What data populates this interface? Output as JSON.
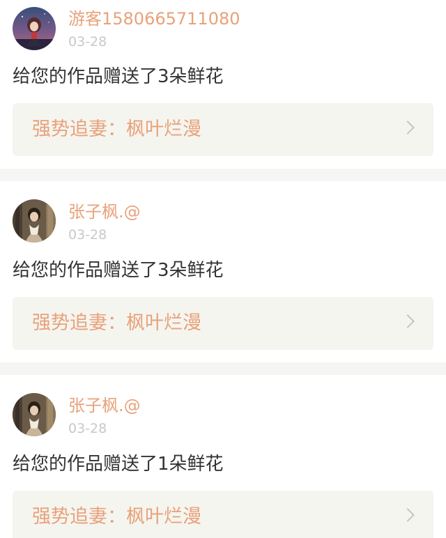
{
  "notifications": [
    {
      "username": "游客1580665711080",
      "date": "03-28",
      "message": "给您的作品赠送了3朵鲜花",
      "work_title": "强势追妻：枫叶烂漫",
      "avatar": "avatar-girl-icon"
    },
    {
      "username": "张子枫.@",
      "date": "03-28",
      "message": "给您的作品赠送了3朵鲜花",
      "work_title": "强势追妻：枫叶烂漫",
      "avatar": "avatar-photo-icon"
    },
    {
      "username": "张子枫.@",
      "date": "03-28",
      "message": "给您的作品赠送了1朵鲜花",
      "work_title": "强势追妻：枫叶烂漫",
      "avatar": "avatar-photo-icon"
    }
  ],
  "colors": {
    "accent": "#e8a27a",
    "date": "#c8c8c8",
    "text": "#333333",
    "link_bg": "#f5f5f0",
    "divider": "#f5f5f3"
  }
}
